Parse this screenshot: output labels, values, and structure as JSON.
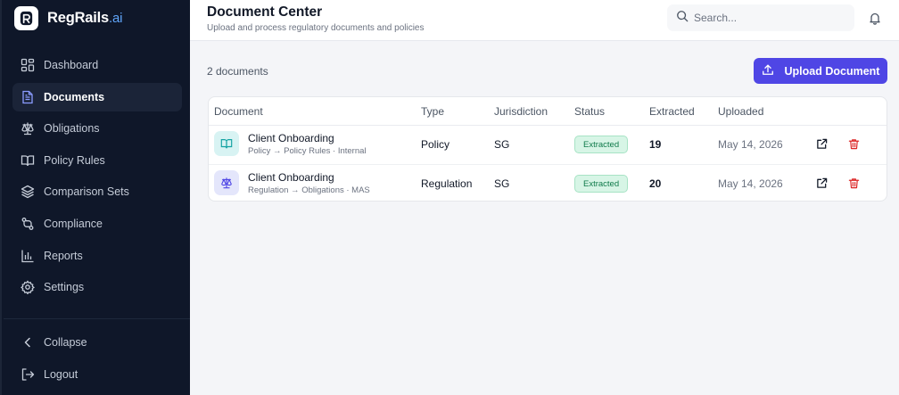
{
  "app": {
    "name": "RegRails",
    "name_suffix": ".ai",
    "logo_letter": "R"
  },
  "sidebar": {
    "items": [
      {
        "label": "Dashboard",
        "icon": "dashboard-grid-icon",
        "active": false
      },
      {
        "label": "Documents",
        "icon": "document-icon",
        "active": true
      },
      {
        "label": "Obligations",
        "icon": "scale-icon",
        "active": false
      },
      {
        "label": "Policy Rules",
        "icon": "book-open-icon",
        "active": false
      },
      {
        "label": "Comparison Sets",
        "icon": "layers-icon",
        "active": false
      },
      {
        "label": "Compliance",
        "icon": "git-compare-icon",
        "active": false
      },
      {
        "label": "Reports",
        "icon": "bar-chart-icon",
        "active": false
      },
      {
        "label": "Settings",
        "icon": "gear-icon",
        "active": false
      }
    ],
    "bottom": [
      {
        "label": "Collapse",
        "icon": "chevron-left-icon"
      },
      {
        "label": "Logout",
        "icon": "logout-icon"
      }
    ]
  },
  "header": {
    "title": "Document Center",
    "subtitle": "Upload and process regulatory documents and policies",
    "search_placeholder": "Search..."
  },
  "main": {
    "doc_count": "2 documents",
    "upload_label": "Upload Document"
  },
  "table": {
    "columns": [
      "Document",
      "Type",
      "Jurisdiction",
      "Status",
      "Extracted",
      "Uploaded"
    ],
    "rows": [
      {
        "name": "Client Onboarding",
        "subtitle": "Policy → Policy Rules · Internal",
        "icon": "book-open-icon",
        "type": "Policy",
        "jurisdiction": "SG",
        "status": "Extracted",
        "extracted": "19",
        "uploaded": "May 14, 2026"
      },
      {
        "name": "Client Onboarding",
        "subtitle": "Regulation → Obligations · MAS",
        "icon": "scale-icon",
        "type": "Regulation",
        "jurisdiction": "SG",
        "status": "Extracted",
        "extracted": "20",
        "uploaded": "May 14, 2026"
      }
    ]
  },
  "colors": {
    "sidebar_bg": "#0f1729",
    "accent": "#4f46e5",
    "status_green": "#0f7a4a",
    "delete_red": "#dc2626",
    "brand_suffix": "#60a5fa"
  }
}
